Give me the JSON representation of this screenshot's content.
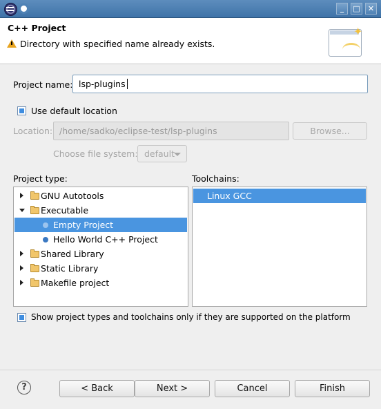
{
  "titlebar": {
    "app_icon": "eclipse-icon",
    "pin_icon": "pin-icon",
    "minimize": "_",
    "maximize": "□",
    "close": "✕"
  },
  "header": {
    "title": "C++ Project",
    "message": "Directory with specified name already exists.",
    "warning_icon": "warning-icon",
    "wizard_icon": "wizard-banner-icon"
  },
  "form": {
    "project_name_label": "Project name:",
    "project_name_value": "lsp-plugins",
    "use_default_location_label": "Use default location",
    "use_default_location_checked": true,
    "location_label": "Location:",
    "location_value": "/home/sadko/eclipse-test/lsp-plugins",
    "browse_label": "Browse...",
    "filesystem_label": "Choose file system:",
    "filesystem_value": "default"
  },
  "project_type": {
    "label": "Project type:",
    "items": [
      {
        "label": "GNU Autotools",
        "kind": "folder",
        "expanded": false
      },
      {
        "label": "Executable",
        "kind": "folder",
        "expanded": true
      },
      {
        "label": "Empty Project",
        "kind": "leaf",
        "selected": true
      },
      {
        "label": "Hello World C++ Project",
        "kind": "leaf",
        "selected": false
      },
      {
        "label": "Shared Library",
        "kind": "folder",
        "expanded": false
      },
      {
        "label": "Static Library",
        "kind": "folder",
        "expanded": false
      },
      {
        "label": "Makefile project",
        "kind": "folder",
        "expanded": false
      }
    ]
  },
  "toolchains": {
    "label": "Toolchains:",
    "items": [
      {
        "label": "Linux GCC",
        "selected": true
      }
    ]
  },
  "filter": {
    "label": "Show project types and toolchains only if they are supported on the platform",
    "checked": true
  },
  "footer": {
    "help_icon": "help-icon",
    "back_label": "< Back",
    "next_label": "Next >",
    "cancel_label": "Cancel",
    "finish_label": "Finish"
  },
  "colors": {
    "selection": "#4a95e0",
    "titlebar": "#4f82b5",
    "checkbox": "#3e8de0"
  }
}
